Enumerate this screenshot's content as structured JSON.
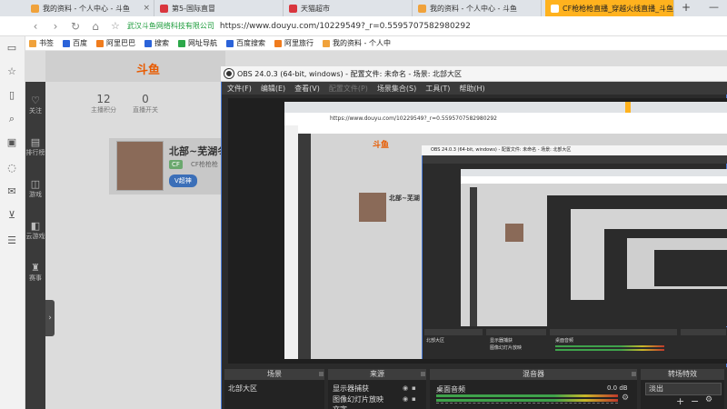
{
  "browser": {
    "tabs": [
      {
        "title": "我的资料 - 个人中心 - 斗鱼",
        "color": "#f0a23b",
        "active": false
      },
      {
        "title": "第5-国际直冒",
        "color": "#d9363e",
        "active": false
      },
      {
        "title": "天猫超市",
        "color": "#d9363e",
        "active": false
      },
      {
        "title": "我的资料 - 个人中心 - 斗鱼",
        "color": "#f0a23b",
        "active": false
      },
      {
        "title": "CF枪枪枪直播_穿越火线直播_斗鱼直播",
        "color": "#ffffff",
        "active": true
      }
    ],
    "new_tab": "+",
    "window_min": "—",
    "nav": {
      "back": "‹",
      "forward": "›",
      "reload": "↻",
      "home": "⌂",
      "star": "☆"
    },
    "site_badge": "武汉斗鱼网络科技有限公司",
    "url": "https://www.douyu.com/10229549?_r=0.5595707582980292"
  },
  "bookmarks": [
    {
      "label": "书签",
      "color": "#f0a23b"
    },
    {
      "label": "百度",
      "color": "#2b63d9"
    },
    {
      "label": "阿里巴巴",
      "color": "#f07c1e"
    },
    {
      "label": "搜索",
      "color": "#2b63d9"
    },
    {
      "label": "网址导航",
      "color": "#2ca84a"
    },
    {
      "label": "百度搜索",
      "color": "#2b63d9"
    },
    {
      "label": "阿里旅行",
      "color": "#f07c1e"
    },
    {
      "label": "我的资料 - 个人中",
      "color": "#f0a23b"
    }
  ],
  "sidebar_icons": [
    "window-icon",
    "star-icon",
    "book-icon",
    "search-icon",
    "video-icon",
    "chat-icon",
    "mail-icon",
    "cart-icon",
    "list-icon"
  ],
  "douyu": {
    "logo": "斗鱼",
    "nav": [
      {
        "label": "关注"
      },
      {
        "label": "排行榜"
      },
      {
        "label": "游戏"
      },
      {
        "label": "云游戏"
      },
      {
        "label": "赛事"
      }
    ],
    "stats": {
      "num": "12",
      "label": "主播积分",
      "num2": "0",
      "label2": "直播开关"
    },
    "anchor_name": "北部~芜湖冬",
    "badge": "CF",
    "badge_text": "CF枪枪枪",
    "vip": "V超神",
    "collapse": "›"
  },
  "obs": {
    "title": "OBS 24.0.3 (64-bit, windows) - 配置文件: 未命名 - 场景: 北部大区",
    "menu": [
      "文件(F)",
      "编辑(E)",
      "查看(V)",
      "配置文件(P)",
      "场景集合(S)",
      "工具(T)",
      "帮助(H)"
    ],
    "menu_disabled": [
      false,
      false,
      false,
      true,
      false,
      false,
      false
    ],
    "docks": {
      "scenes": {
        "title": "场景",
        "items": [
          "北部大区"
        ]
      },
      "sources": {
        "title": "来源",
        "items": [
          "显示器捕获",
          "图像幻灯片放映",
          "文字"
        ]
      },
      "mixer": {
        "title": "混音器",
        "channel": "桌面音频",
        "level": "0.0 dB"
      },
      "transitions": {
        "title": "转场特效",
        "value": "淡出"
      }
    }
  },
  "nested": {
    "obs_title": "OBS 24.0.3 (64-bit, windows) - 配置文件: 未命名 - 场景: 北部大区",
    "url": "https://www.douyu.com/10229549?_r=0.5595707582980292",
    "anchor_name": "北部~芜湖",
    "logo": "斗鱼",
    "scene": "北部大区",
    "source1": "显示器捕获",
    "source2": "图像幻灯片放映",
    "mixer_label": "桌面音频"
  }
}
